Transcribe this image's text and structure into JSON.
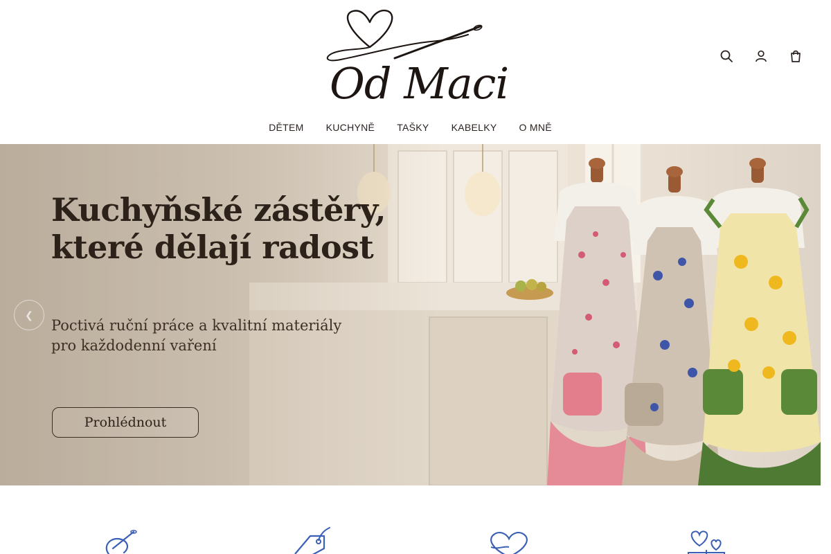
{
  "brand": {
    "name": "Od Maci"
  },
  "header": {
    "icons": [
      {
        "name": "search-icon"
      },
      {
        "name": "account-icon"
      },
      {
        "name": "cart-icon"
      }
    ]
  },
  "nav": {
    "items": [
      {
        "label": "DĚTEM"
      },
      {
        "label": "KUCHYNĚ"
      },
      {
        "label": "TAŠKY"
      },
      {
        "label": "KABELKY"
      },
      {
        "label": "O MNĚ"
      }
    ]
  },
  "hero": {
    "title_line1": "Kuchyňské zástěry,",
    "title_line2": "které dělají radost",
    "subtitle_line1": "Poctivá ruční práce a kvalitní materiály",
    "subtitle_line2": "pro každodenní vaření",
    "button_label": "Prohlédnout"
  },
  "features": [
    {
      "icon": "needle-thread-icon"
    },
    {
      "icon": "price-tag-icon"
    },
    {
      "icon": "heart-hands-icon"
    },
    {
      "icon": "hearts-gift-icon"
    }
  ],
  "colors": {
    "accent_blue": "#3b5fb5",
    "text_dark": "#2b2320",
    "hero_beige": "#e4dacb",
    "apron_pink": "#e07a8a",
    "apron_green": "#4f7a33"
  }
}
